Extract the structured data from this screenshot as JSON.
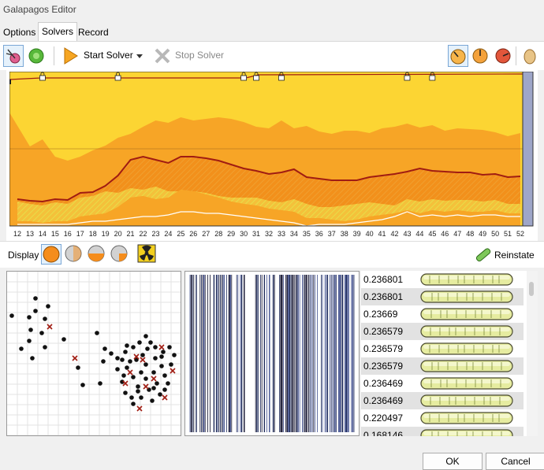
{
  "window": {
    "title": "Galapagos Editor"
  },
  "tabs": [
    {
      "label": "Options"
    },
    {
      "label": "Solvers",
      "active": true
    },
    {
      "label": "Record"
    }
  ],
  "toolbar": {
    "start_label": "Start Solver",
    "stop_label": "Stop Solver",
    "icons": [
      "evolutionary-solver-icon",
      "annealing-solver-icon",
      "play-icon",
      "dropdown-arrow-icon",
      "stop-x-icon",
      "gauge-slow-icon",
      "gauge-medium-icon",
      "gauge-fast-icon",
      "egg-icon"
    ]
  },
  "chart_data": {
    "type": "area",
    "x_ticks": [
      12,
      13,
      14,
      15,
      16,
      17,
      18,
      19,
      20,
      21,
      22,
      23,
      24,
      25,
      26,
      27,
      28,
      29,
      30,
      31,
      32,
      33,
      34,
      35,
      36,
      37,
      38,
      39,
      40,
      41,
      42,
      43,
      44,
      45,
      46,
      47,
      48,
      49,
      50,
      51,
      52
    ],
    "milestone_labels": [
      14,
      20,
      30,
      31,
      33,
      43,
      45
    ],
    "colors": {
      "top": "#fcd533",
      "upper": "#f7a526",
      "middle": "#f2901b",
      "lower": "#f7a526",
      "hatch": "#f4d334",
      "line": "#a01c12"
    }
  },
  "display": {
    "label": "Display",
    "reinstate_label": "Reinstate"
  },
  "genomes": [
    {
      "value": "0.236801"
    },
    {
      "value": "0.236801"
    },
    {
      "value": "0.23669"
    },
    {
      "value": "0.236579"
    },
    {
      "value": "0.236579"
    },
    {
      "value": "0.236579"
    },
    {
      "value": "0.236469"
    },
    {
      "value": "0.236469"
    },
    {
      "value": "0.220497"
    },
    {
      "value": "0.168146"
    }
  ],
  "buttons": {
    "ok_label": "OK",
    "cancel_label": "Cancel"
  }
}
